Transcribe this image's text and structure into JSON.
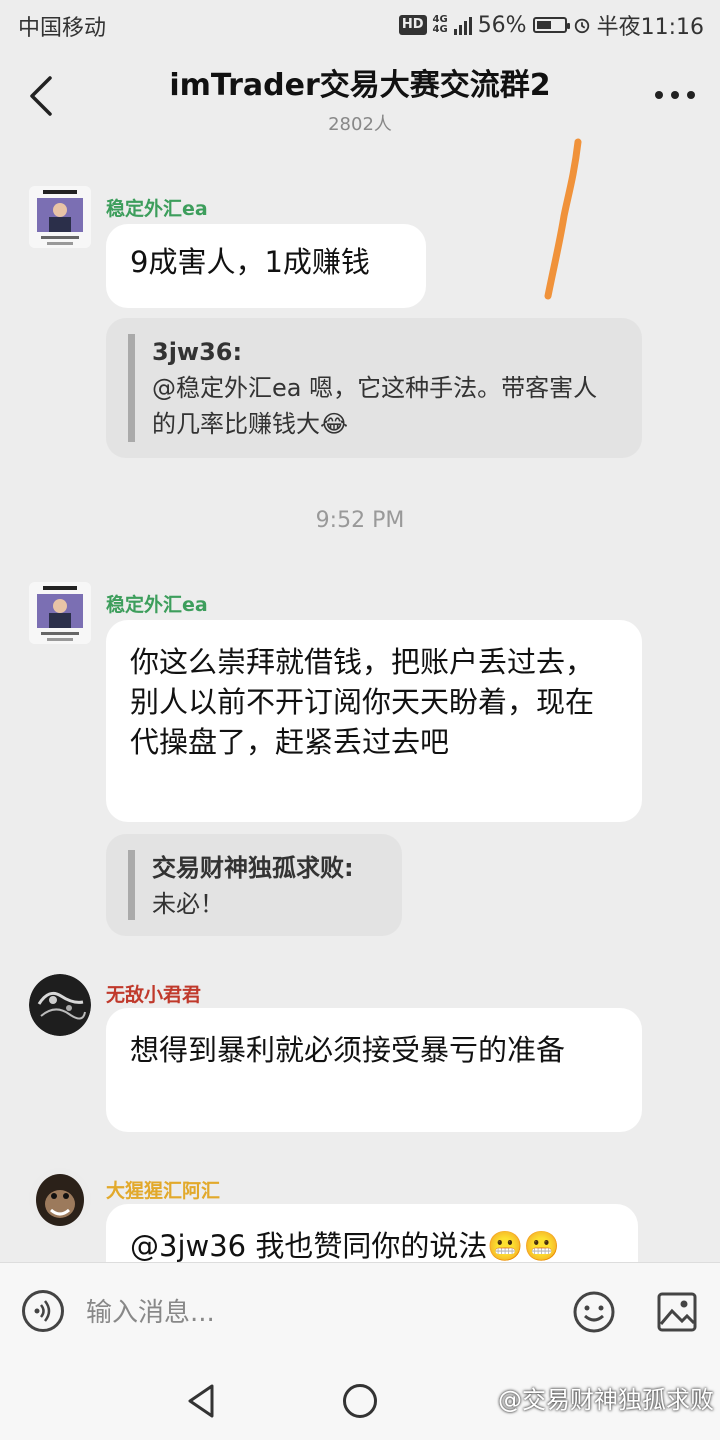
{
  "status": {
    "carrier": "中国移动",
    "hd": "HD",
    "network_top": "4G",
    "network_bottom": "4G",
    "battery_percent": "56%",
    "battery_level": 0.56,
    "time": "半夜11:16"
  },
  "header": {
    "title": "imTrader交易大赛交流群2",
    "member_count": "2802人"
  },
  "messages": [
    {
      "sender": "稳定外汇ea",
      "sender_color": "#3d9e5c",
      "avatar_icon": "trading-avatar",
      "text": "9成害人，1成赚钱",
      "quote_name": "3jw36:",
      "quote_text": "@稳定外汇ea 嗯，它这种手法。带客害人的几率比赚钱大😂"
    },
    {
      "sender": "稳定外汇ea",
      "sender_color": "#3d9e5c",
      "avatar_icon": "trading-avatar",
      "text": "你这么崇拜就借钱，把账户丢过去，别人以前不开订阅你天天盼着，现在代操盘了，赶紧丢过去吧",
      "quote_name": "交易财神独孤求败:",
      "quote_text": "未必！"
    },
    {
      "sender": "无敌小君君",
      "sender_color": "#c0392b",
      "avatar_icon": "ink-avatar",
      "text": "想得到暴利就必须接受暴亏的准备"
    },
    {
      "sender": "大猩猩汇阿汇",
      "sender_color": "#e2a92b",
      "avatar_icon": "chimp-avatar",
      "text": "@3jw36 我也赞同你的说法😬😬"
    }
  ],
  "timestamp": "9:52 PM",
  "input": {
    "placeholder": "输入消息..."
  },
  "watermark": "@交易财神独孤求败",
  "annotation_color": "#f0923a"
}
